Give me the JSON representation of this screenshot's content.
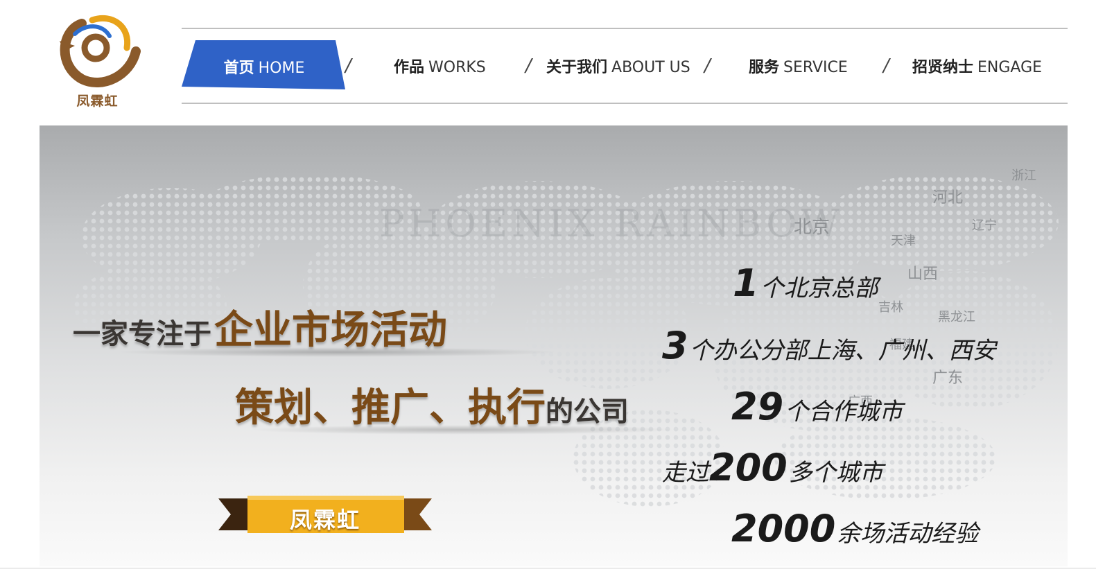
{
  "logo": {
    "text": "凤霖虹",
    "icon": "phoenix-logo-icon",
    "colors": {
      "brown": "#8a5a2b",
      "gold": "#e8a31b",
      "blue": "#2d6fd0"
    }
  },
  "nav": {
    "items": [
      {
        "cn": "首页",
        "en": "HOME",
        "active": true
      },
      {
        "cn": "作品",
        "en": "WORKS"
      },
      {
        "cn": "关于我们",
        "en": "ABOUT US"
      },
      {
        "cn": "服务",
        "en": "SERVICE"
      },
      {
        "cn": "招贤纳士",
        "en": "ENGAGE"
      }
    ],
    "separator": "/",
    "active_color": "#2f62c7"
  },
  "banner": {
    "watermark": "PHOENIX RAINBOW",
    "provinces": [
      "浙江",
      "河北",
      "北京",
      "辽宁",
      "天津",
      "山西",
      "吉林",
      "黑龙江",
      "福建",
      "广东",
      "广西"
    ],
    "headline1_prefix": "一家专注于",
    "headline1_highlight": "企业市场活动",
    "headline2_highlight": "策划、推广、执行",
    "headline2_suffix": "的公司",
    "ribbon_text": "凤霖虹",
    "ribbon_color": "#f2b01e",
    "stats": [
      {
        "prefix": "",
        "num": "1",
        "text": "个北京总部"
      },
      {
        "prefix": "",
        "num": "3",
        "text": "个办公分部上海、广州、西安"
      },
      {
        "prefix": "",
        "num": "29",
        "text": "个合作城市"
      },
      {
        "prefix": "走过",
        "num": "200",
        "text": "多个城市"
      },
      {
        "prefix": "",
        "num": "2000",
        "text": "余场活动经验"
      }
    ]
  }
}
